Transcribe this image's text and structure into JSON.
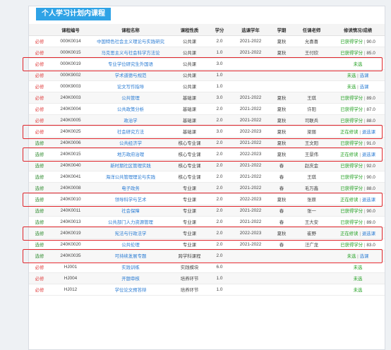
{
  "title": "个人学习计划内课程",
  "headers": [
    "",
    "课程编号",
    "课程名称",
    "课程性质",
    "学分",
    "选课学年",
    "学期",
    "任课老师",
    "修读情况/成绩"
  ],
  "rows": [
    {
      "type": "必修",
      "code": "000K0014",
      "name": "中国特色社会主义理论与实践研究",
      "nature": "公共课",
      "credit": "2.0",
      "year": "2021-2022",
      "term": "夏秋",
      "teacher": "允喜喜",
      "status": "已获得学分",
      "score": "90.0",
      "status_color": "green"
    },
    {
      "type": "必修",
      "code": "000K0015",
      "name": "马克思主义与社会科学方法论",
      "nature": "公共课",
      "credit": "1.0",
      "year": "2021-2022",
      "term": "夏秋",
      "teacher": "王付欣",
      "status": "已获得学分",
      "score": "85.0",
      "status_color": "green"
    },
    {
      "type": "必修",
      "code": "000K0019",
      "name": "专业学位研究生外国语",
      "nature": "公共课",
      "credit": "3.0",
      "year": "",
      "term": "",
      "teacher": "",
      "status": "未选",
      "score": "",
      "status_color": "green"
    },
    {
      "type": "必修",
      "code": "000K9002",
      "name": "学术道德与规范",
      "nature": "公共课",
      "credit": "1.0",
      "year": "",
      "term": "",
      "teacher": "",
      "status": "未选",
      "score": "",
      "link": "选课",
      "status_color": "green"
    },
    {
      "type": "必修",
      "code": "000K9003",
      "name": "论文写作指导",
      "nature": "公共课",
      "credit": "1.0",
      "year": "",
      "term": "",
      "teacher": "",
      "status": "未选",
      "score": "",
      "link": "选课",
      "status_color": "green"
    },
    {
      "type": "必修",
      "code": "240K0003",
      "name": "公共管理",
      "nature": "基础课",
      "credit": "3.0",
      "year": "2021-2022",
      "term": "夏秋",
      "teacher": "王琪",
      "status": "已获得学分",
      "score": "89.0",
      "status_color": "green"
    },
    {
      "type": "必修",
      "code": "240K0004",
      "name": "公共政策分析",
      "nature": "基础课",
      "credit": "2.0",
      "year": "2021-2022",
      "term": "夏秋",
      "teacher": "许阳",
      "status": "已获得学分",
      "score": "87.0",
      "status_color": "green"
    },
    {
      "type": "必修",
      "code": "240K0005",
      "name": "政治学",
      "nature": "基础课",
      "credit": "2.0",
      "year": "2021-2022",
      "term": "夏秋",
      "teacher": "司联兵",
      "status": "已获得学分",
      "score": "88.0",
      "status_color": "green"
    },
    {
      "type": "必修",
      "code": "240K0025",
      "name": "社会研究方法",
      "nature": "基础课",
      "credit": "3.0",
      "year": "2022-2023",
      "term": "夏秋",
      "teacher": "梁丽",
      "status": "正在修读",
      "score": "",
      "link": "退选课",
      "status_color": "green"
    },
    {
      "type": "选修",
      "code": "240K0006",
      "name": "公共经济学",
      "nature": "核心专业课",
      "credit": "2.0",
      "year": "2021-2022",
      "term": "夏秋",
      "teacher": "王文阳",
      "status": "已获得学分",
      "score": "91.0",
      "status_color": "green"
    },
    {
      "type": "选修",
      "code": "240K0015",
      "name": "地方政府治理",
      "nature": "核心专业课",
      "credit": "2.0",
      "year": "2022-2023",
      "term": "夏秋",
      "teacher": "王景伟",
      "status": "正在修读",
      "score": "",
      "link": "退选课",
      "status_color": "green"
    },
    {
      "type": "选修",
      "code": "240K0040",
      "name": "新时期社区管理实践",
      "nature": "核心专业课",
      "credit": "2.0",
      "year": "2021-2022",
      "term": "春",
      "teacher": "赵庆金",
      "status": "已获得学分",
      "score": "92.0",
      "status_color": "green"
    },
    {
      "type": "选修",
      "code": "240K0041",
      "name": "海洋公共管理理论与实践",
      "nature": "核心专业课",
      "credit": "2.0",
      "year": "2021-2022",
      "term": "春",
      "teacher": "王琪",
      "status": "已获得学分",
      "score": "90.0",
      "status_color": "green"
    },
    {
      "type": "选修",
      "code": "240K0008",
      "name": "电子政务",
      "nature": "专业课",
      "credit": "2.0",
      "year": "2021-2022",
      "term": "春",
      "teacher": "毛万鑫",
      "status": "已获得学分",
      "score": "88.0",
      "status_color": "green"
    },
    {
      "type": "选修",
      "code": "240K0010",
      "name": "领导科学与艺术",
      "nature": "专业课",
      "credit": "2.0",
      "year": "2022-2023",
      "term": "夏秋",
      "teacher": "张原",
      "status": "正在修读",
      "score": "",
      "link": "退选课",
      "status_color": "green"
    },
    {
      "type": "选修",
      "code": "240K0011",
      "name": "社会保障",
      "nature": "专业课",
      "credit": "2.0",
      "year": "2021-2022",
      "term": "春",
      "teacher": "张一",
      "status": "已获得学分",
      "score": "90.0",
      "status_color": "green"
    },
    {
      "type": "选修",
      "code": "240K0013",
      "name": "公共部门人力资源管理",
      "nature": "专业课",
      "credit": "2.0",
      "year": "2021-2022",
      "term": "春",
      "teacher": "王大安",
      "status": "已获得学分",
      "score": "89.0",
      "status_color": "green"
    },
    {
      "type": "选修",
      "code": "240K0019",
      "name": "宪法与行政法学",
      "nature": "专业课",
      "credit": "2.0",
      "year": "2022-2023",
      "term": "夏秋",
      "teacher": "崔野",
      "status": "正在修读",
      "score": "",
      "link": "退选课",
      "status_color": "green"
    },
    {
      "type": "选修",
      "code": "240K0020",
      "name": "公共伦理",
      "nature": "专业课",
      "credit": "2.0",
      "year": "2021-2022",
      "term": "春",
      "teacher": "汪广龙",
      "status": "已获得学分",
      "score": "83.0",
      "status_color": "green"
    },
    {
      "type": "选修",
      "code": "240K0035",
      "name": "可持续发展专题",
      "nature": "跨学科课程",
      "credit": "2.0",
      "year": "",
      "term": "",
      "teacher": "",
      "status": "未选",
      "score": "",
      "link": "选课",
      "status_color": "green"
    },
    {
      "type": "必修",
      "code": "HJ001",
      "name": "实践训练",
      "nature": "实践模块",
      "credit": "6.0",
      "year": "",
      "term": "",
      "teacher": "",
      "status": "未选",
      "score": "",
      "status_color": "green"
    },
    {
      "type": "必修",
      "code": "HJ004",
      "name": "开题审核",
      "nature": "培养环节",
      "credit": "1.0",
      "year": "",
      "term": "",
      "teacher": "",
      "status": "未选",
      "score": "",
      "status_color": "green"
    },
    {
      "type": "必修",
      "code": "HJ012",
      "name": "学位论文预答辩",
      "nature": "培养环节",
      "credit": "1.0",
      "year": "",
      "term": "",
      "teacher": "",
      "status": "未选",
      "score": "",
      "status_color": "green"
    }
  ],
  "highlight_color": "#e0262c"
}
